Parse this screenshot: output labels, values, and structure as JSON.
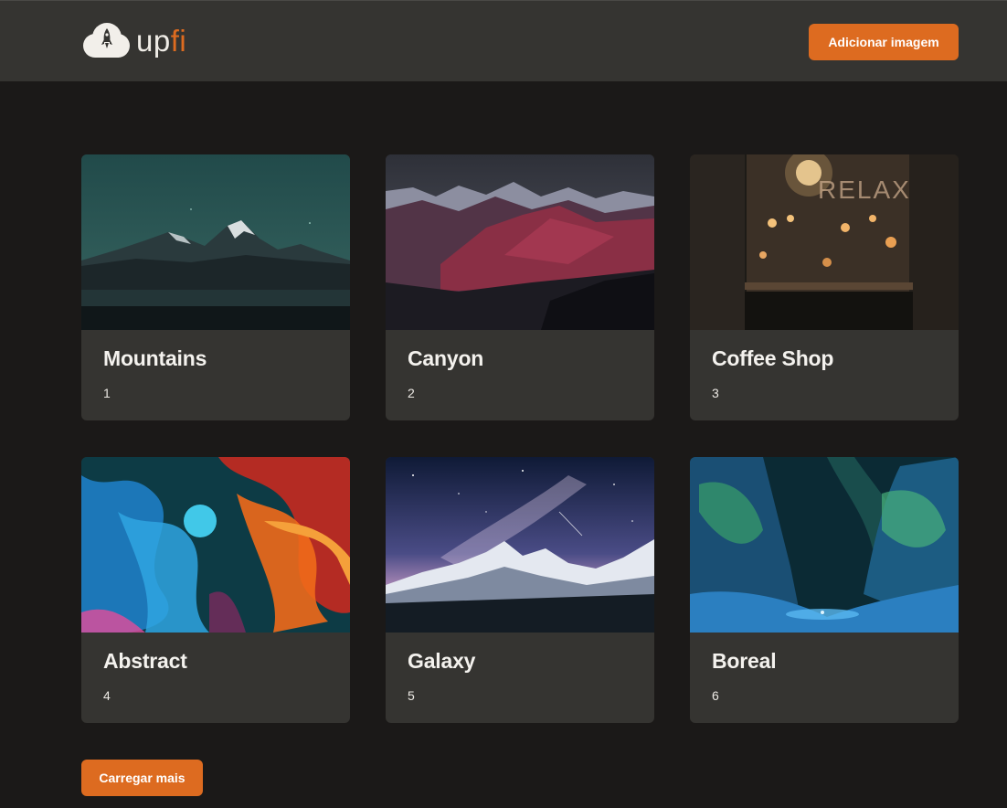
{
  "header": {
    "logo": {
      "icon": "rocket-cloud-icon",
      "text_main": "up",
      "text_accent": "fi"
    },
    "add_image_label": "Adicionar imagem"
  },
  "cards": [
    {
      "title": "Mountains",
      "description": "1",
      "image": "mountains-photo"
    },
    {
      "title": "Canyon",
      "description": "2",
      "image": "canyon-photo"
    },
    {
      "title": "Coffee Shop",
      "description": "3",
      "image": "coffee-shop-photo"
    },
    {
      "title": "Abstract",
      "description": "4",
      "image": "abstract-photo"
    },
    {
      "title": "Galaxy",
      "description": "5",
      "image": "galaxy-photo"
    },
    {
      "title": "Boreal",
      "description": "6",
      "image": "boreal-photo"
    }
  ],
  "load_more_label": "Carregar mais",
  "colors": {
    "background": "#1b1918",
    "header": "#353431",
    "card": "#353431",
    "accent": "#dd6b20",
    "text": "#f4f2ee"
  }
}
